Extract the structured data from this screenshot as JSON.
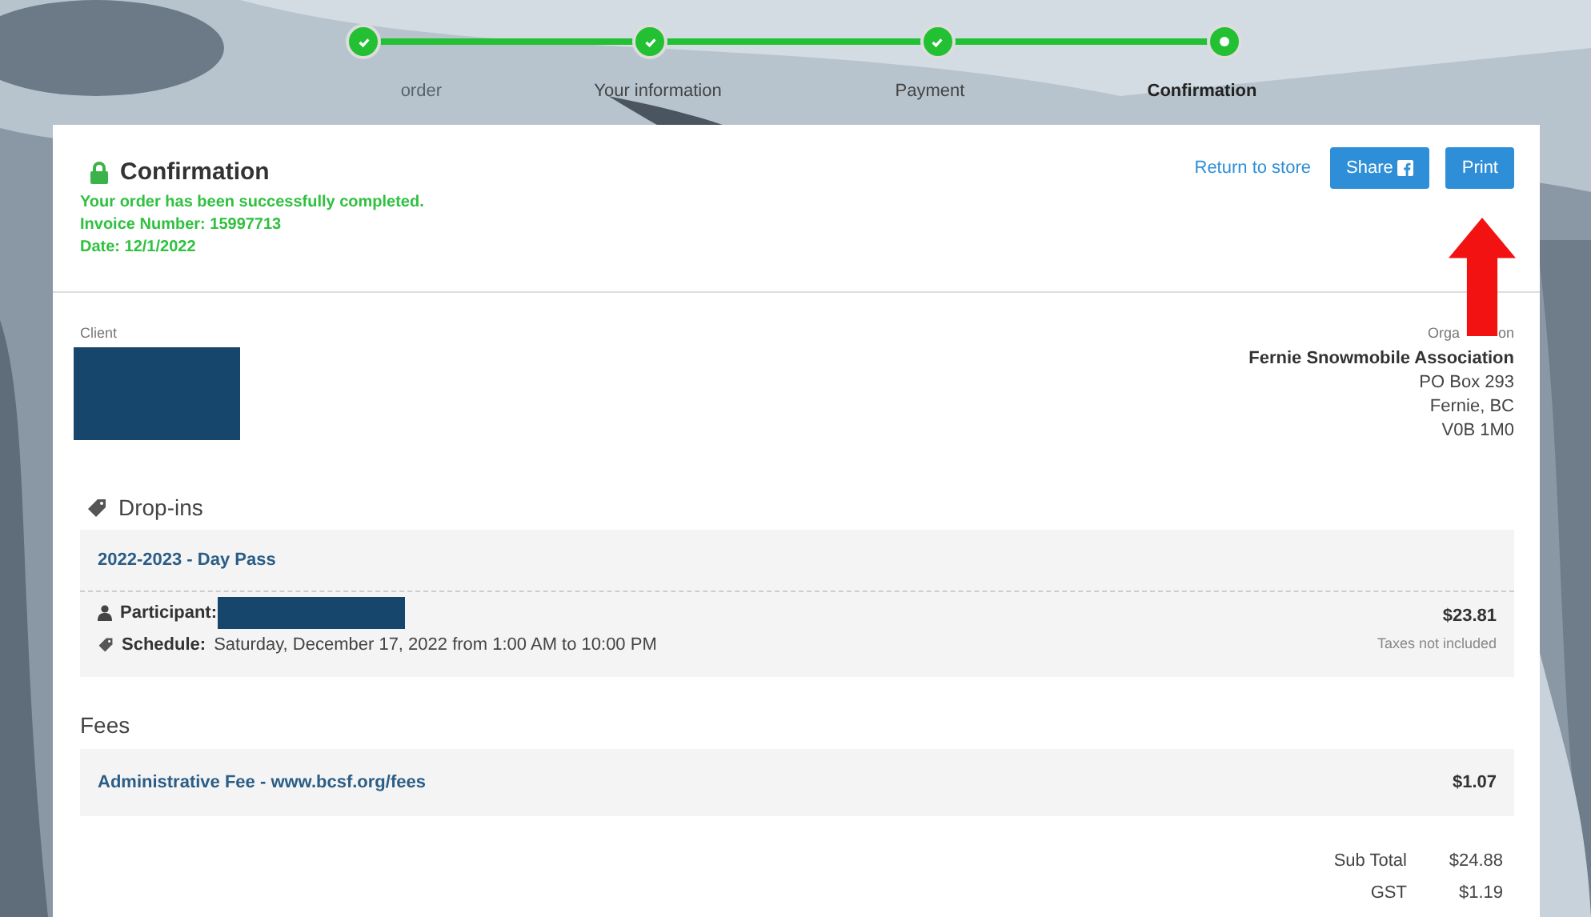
{
  "steps": [
    {
      "label": "order",
      "completed": true,
      "selected": false
    },
    {
      "label": "Your information",
      "completed": true,
      "selected": false
    },
    {
      "label": "Payment",
      "completed": true,
      "selected": false
    },
    {
      "label": "Confirmation",
      "completed": false,
      "selected": true
    }
  ],
  "header": {
    "title": "Confirmation",
    "messages": [
      "Your order has been successfully completed.",
      "Invoice Number: 15997713",
      "Date: 12/1/2022"
    ],
    "return_link": "Return to store",
    "share_button": "Share",
    "print_button": "Print"
  },
  "client": {
    "label": "Client"
  },
  "organization": {
    "label_visible_parts": [
      "Orga",
      "on"
    ],
    "name": "Fernie Snowmobile Association",
    "lines": [
      "PO Box 293",
      "Fernie, BC",
      "V0B 1M0"
    ]
  },
  "dropins": {
    "heading": "Drop-ins",
    "item": {
      "title": "2022-2023 - Day Pass",
      "participant_label": "Participant:",
      "schedule_label": "Schedule:",
      "schedule": "Saturday, December 17, 2022 from 1:00 AM to 10:00 PM",
      "price": "$23.81",
      "tax_note": "Taxes not included"
    }
  },
  "fees": {
    "heading": "Fees",
    "items": [
      {
        "name": "Administrative Fee - www.bcsf.org/fees",
        "amount": "$1.07"
      }
    ]
  },
  "totals": [
    {
      "label": "Sub Total",
      "value": "$24.88"
    },
    {
      "label": "GST",
      "value": "$1.19"
    }
  ]
}
